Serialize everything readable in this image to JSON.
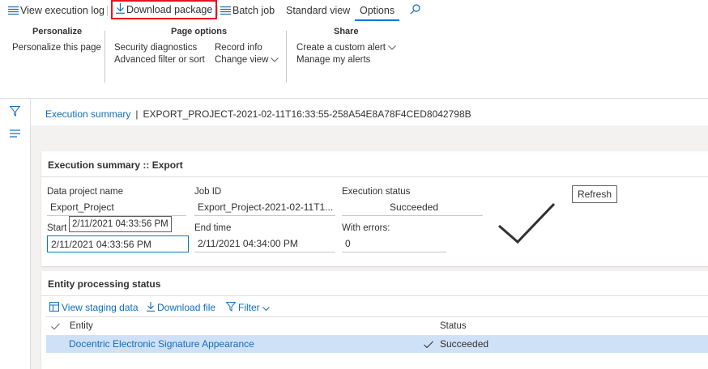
{
  "actionbar": {
    "view_log": "View execution log",
    "download_package": "Download package",
    "batch_job": "Batch job",
    "standard_view": "Standard view",
    "options": "Options"
  },
  "ribbon": {
    "personalize": {
      "title": "Personalize",
      "items": [
        "Personalize this page"
      ]
    },
    "page_options": {
      "title": "Page options",
      "items": [
        "Security diagnostics",
        "Advanced filter or sort",
        "Record info",
        "Change view"
      ]
    },
    "share": {
      "title": "Share",
      "items": [
        "Create a custom alert",
        "Manage my alerts"
      ]
    }
  },
  "breadcrumb": {
    "link": "Execution summary",
    "separator": "|",
    "current": "EXPORT_PROJECT-2021-02-11T16:33:55-258A54E8A78F4CED8042798B"
  },
  "summary_card": {
    "title": "Execution summary :: Export",
    "fields": {
      "data_project_name": {
        "label": "Data project name",
        "value": "Export_Project"
      },
      "job_id": {
        "label": "Job ID",
        "value": "Export_Project-2021-02-11T1..."
      },
      "execution_status": {
        "label": "Execution status",
        "value": "Succeeded"
      },
      "start": {
        "label": "Start",
        "value": "2/11/2021 04:33:56 PM",
        "tooltip": "2/11/2021 04:33:56 PM"
      },
      "end_time": {
        "label": "End time",
        "value": "2/11/2021 04:34:00 PM"
      },
      "with_errors": {
        "label": "With errors:",
        "value": "0"
      }
    },
    "refresh": "Refresh"
  },
  "entity_card": {
    "title": "Entity processing status",
    "toolbar": [
      "View staging data",
      "Download file",
      "Filter"
    ],
    "columns": [
      "Entity",
      "Status"
    ],
    "rows": [
      {
        "entity": "Docentric Electronic Signature Appearance",
        "status": "Succeeded"
      }
    ]
  },
  "colors": {
    "accent": "#0078d4",
    "link": "#0f6cbd",
    "highlight": "#e81123",
    "selected_row": "#cfe1f6"
  }
}
